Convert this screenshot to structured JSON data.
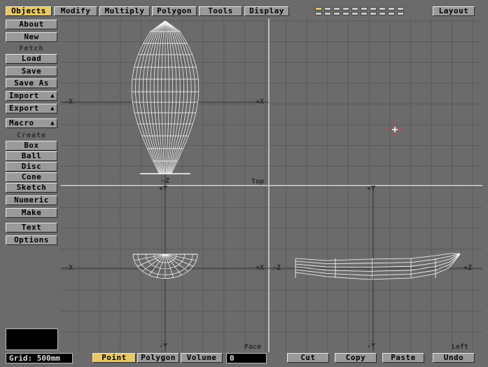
{
  "toolbar": {
    "tabs": [
      "Objects",
      "Modify",
      "Multiply",
      "Polygon",
      "Tools",
      "Display"
    ],
    "active_tab": "Objects",
    "layout_button": "Layout"
  },
  "sidebar": {
    "about": "About",
    "new": "New",
    "fetch_header": "Fetch",
    "load": "Load",
    "save": "Save",
    "save_as": "Save As",
    "import": "Import",
    "export": "Export",
    "macro": "Macro",
    "create_header": "Create",
    "box": "Box",
    "ball": "Ball",
    "disc": "Disc",
    "cone": "Cone",
    "sketch": "Sketch",
    "numeric": "Numeric",
    "make": "Make",
    "text": "Text",
    "options": "Options"
  },
  "viewports": {
    "top": {
      "label": "Top",
      "minus_h": "-X",
      "plus_h": "+X",
      "minus_v": "-Z"
    },
    "face": {
      "label": "Face",
      "minus_h": "-X",
      "plus_h": "+X",
      "plus_v": "+Y",
      "minus_v": "-Y"
    },
    "left": {
      "label": "Left",
      "minus_h": "-Z",
      "plus_h": "+Z",
      "plus_v": "+Y",
      "minus_v": "-Y"
    }
  },
  "bottom": {
    "grid": "Grid: 500mm",
    "modes": [
      "Point",
      "Polygon",
      "Volume"
    ],
    "active_mode": "Point",
    "count": "0",
    "cut": "Cut",
    "copy": "Copy",
    "paste": "Paste",
    "undo": "Undo"
  },
  "colors": {
    "active": "#e8c860",
    "background": "#6b6b6b",
    "grid": "#5a5a5a",
    "wire": "#ffffff",
    "marker": "#ff3030"
  }
}
